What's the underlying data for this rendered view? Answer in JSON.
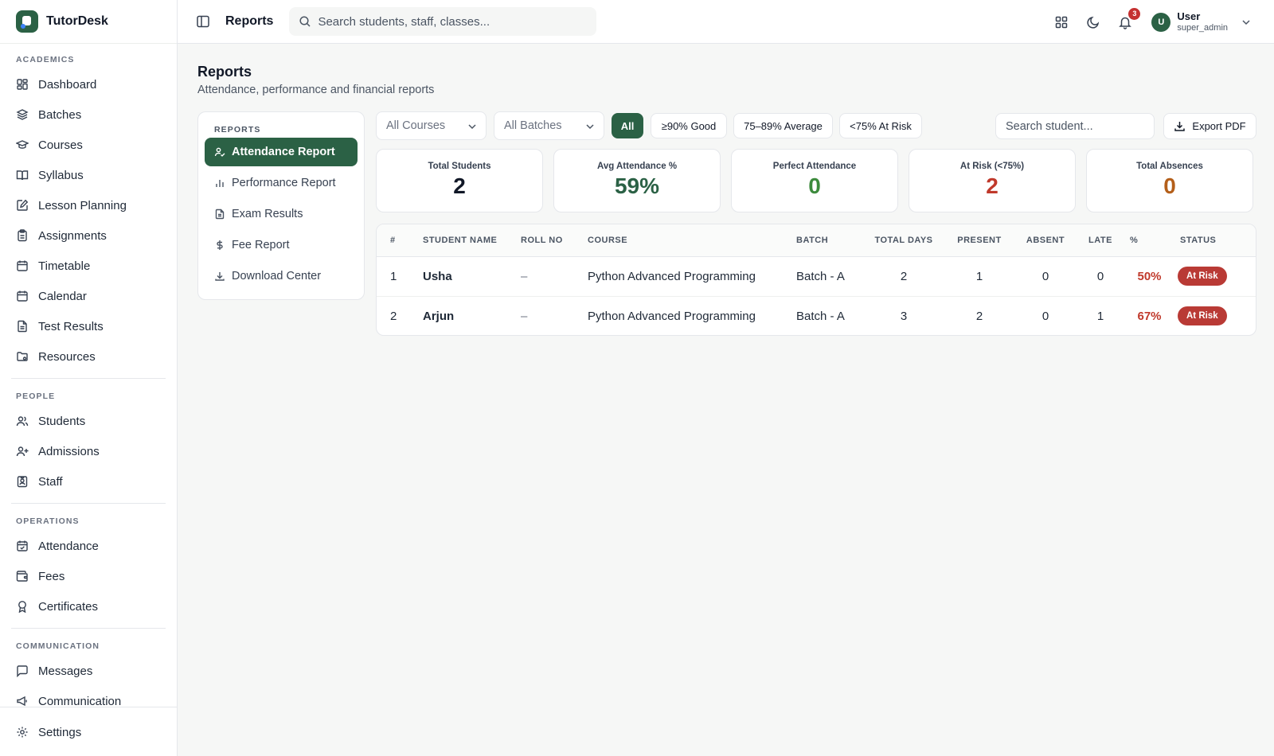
{
  "brand": {
    "name": "TutorDesk"
  },
  "sidebar": {
    "sections": [
      {
        "label": "ACADEMICS",
        "items": [
          {
            "label": "Dashboard",
            "icon": "dashboard-icon"
          },
          {
            "label": "Batches",
            "icon": "layers-icon"
          },
          {
            "label": "Courses",
            "icon": "graduation-cap-icon"
          },
          {
            "label": "Syllabus",
            "icon": "book-open-icon"
          },
          {
            "label": "Lesson Planning",
            "icon": "edit-note-icon"
          },
          {
            "label": "Assignments",
            "icon": "clipboard-icon"
          },
          {
            "label": "Timetable",
            "icon": "calendar-icon"
          },
          {
            "label": "Calendar",
            "icon": "calendar-icon"
          },
          {
            "label": "Test Results",
            "icon": "file-text-icon"
          },
          {
            "label": "Resources",
            "icon": "folder-icon"
          }
        ]
      },
      {
        "label": "PEOPLE",
        "items": [
          {
            "label": "Students",
            "icon": "users-icon"
          },
          {
            "label": "Admissions",
            "icon": "user-plus-icon"
          },
          {
            "label": "Staff",
            "icon": "id-badge-icon"
          }
        ]
      },
      {
        "label": "OPERATIONS",
        "items": [
          {
            "label": "Attendance",
            "icon": "calendar-check-icon"
          },
          {
            "label": "Fees",
            "icon": "wallet-icon"
          },
          {
            "label": "Certificates",
            "icon": "award-icon"
          }
        ]
      },
      {
        "label": "COMMUNICATION",
        "items": [
          {
            "label": "Messages",
            "icon": "message-square-icon"
          },
          {
            "label": "Communication",
            "icon": "megaphone-icon"
          }
        ]
      }
    ],
    "footer": {
      "label": "Settings",
      "icon": "gear-icon"
    }
  },
  "topbar": {
    "title": "Reports",
    "search_placeholder": "Search students, staff, classes...",
    "notifications_count": "3",
    "user": {
      "initial": "U",
      "name": "User",
      "role": "super_admin"
    }
  },
  "page": {
    "title": "Reports",
    "subtitle": "Attendance, performance and financial reports"
  },
  "reports_menu": {
    "label": "REPORTS",
    "items": [
      {
        "label": "Attendance Report",
        "icon": "user-check-icon",
        "active": true
      },
      {
        "label": "Performance Report",
        "icon": "bar-chart-icon",
        "active": false
      },
      {
        "label": "Exam Results",
        "icon": "file-text-icon",
        "active": false
      },
      {
        "label": "Fee Report",
        "icon": "dollar-icon",
        "active": false
      },
      {
        "label": "Download Center",
        "icon": "download-icon",
        "active": false
      }
    ]
  },
  "filters": {
    "course_select": "All Courses",
    "batch_select": "All Batches",
    "chips": [
      "All",
      "≥90% Good",
      "75–89% Average",
      "<75% At Risk"
    ],
    "active_chip": "All",
    "search_placeholder": "Search student...",
    "export_label": "Export PDF"
  },
  "stats": [
    {
      "label": "Total Students",
      "value": "2",
      "color": "#111827"
    },
    {
      "label": "Avg Attendance %",
      "value": "59%",
      "color": "#2b6145"
    },
    {
      "label": "Perfect Attendance",
      "value": "0",
      "color": "#3d8b3d"
    },
    {
      "label": "At Risk (<75%)",
      "value": "2",
      "color": "#c0392b"
    },
    {
      "label": "Total Absences",
      "value": "0",
      "color": "#b45f1a"
    }
  ],
  "table": {
    "headers": [
      "#",
      "STUDENT NAME",
      "ROLL NO",
      "COURSE",
      "BATCH",
      "TOTAL DAYS",
      "PRESENT",
      "ABSENT",
      "LATE",
      "%",
      "STATUS"
    ],
    "rows": [
      {
        "num": "1",
        "name": "Usha",
        "roll": "–",
        "course": "Python Advanced Programming",
        "batch": "Batch - A",
        "total_days": "2",
        "present": "1",
        "absent": "0",
        "late": "0",
        "pct": "50%",
        "status": "At Risk"
      },
      {
        "num": "2",
        "name": "Arjun",
        "roll": "–",
        "course": "Python Advanced Programming",
        "batch": "Batch - A",
        "total_days": "3",
        "present": "2",
        "absent": "0",
        "late": "1",
        "pct": "67%",
        "status": "At Risk"
      }
    ]
  }
}
